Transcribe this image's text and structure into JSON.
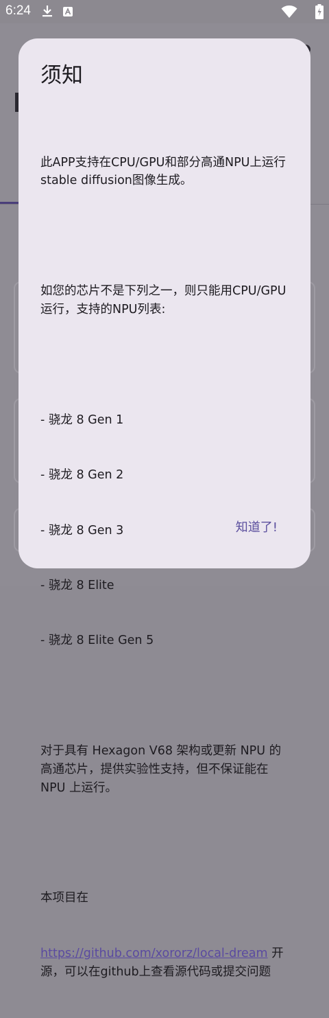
{
  "status_bar": {
    "time": "6:24",
    "icons": [
      "download-icon",
      "a-badge-icon",
      "wifi-icon",
      "battery-icon"
    ]
  },
  "dialog": {
    "title": "须知",
    "paragraph_1": "此APP支持在CPU/GPU和部分高通NPU上运行stable diffusion图像生成。",
    "paragraph_2": "如您的芯片不是下列之一，则只能用CPU/GPU运行，支持的NPU列表:",
    "npu_list": [
      "- 骁龙 8 Gen 1",
      "- 骁龙 8 Gen 2",
      "- 骁龙 8 Gen 3",
      "- 骁龙 8 Elite",
      "- 骁龙 8 Elite Gen 5"
    ],
    "paragraph_3": "对于具有 Hexagon V68 架构或更新 NPU 的高通芯片，提供实验性支持，但不保证能在 NPU 上运行。",
    "project_prefix": "本项目在",
    "project_link": "https://github.com/xororz/local-dream",
    "project_suffix": " 开源，可以在github上查看源代码或提交问题",
    "confirm_label": "知道了!"
  },
  "colors": {
    "dialog_bg": "#ebe6ef",
    "accent": "#5b4f9e",
    "scrim": "#8e8b93"
  }
}
